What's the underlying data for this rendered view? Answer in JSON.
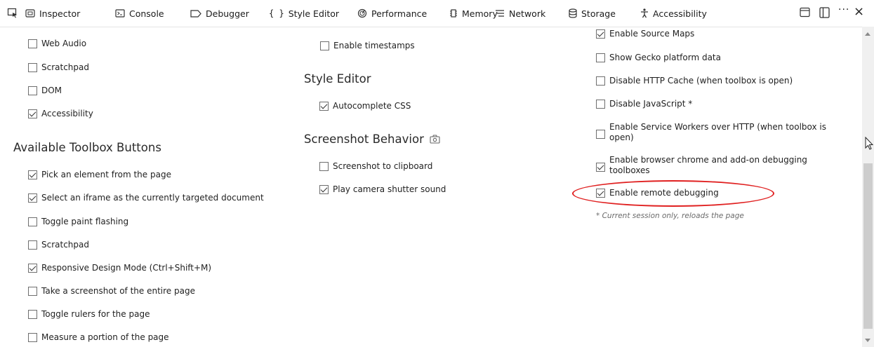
{
  "toolbar": {
    "tabs": [
      {
        "label": "Inspector",
        "icon": "inspector-icon"
      },
      {
        "label": "Console",
        "icon": "console-icon"
      },
      {
        "label": "Debugger",
        "icon": "debugger-icon"
      },
      {
        "label": "Style Editor",
        "icon": "style-editor-icon"
      },
      {
        "label": "Performance",
        "icon": "performance-icon"
      },
      {
        "label": "Memory",
        "icon": "memory-icon"
      },
      {
        "label": "Network",
        "icon": "network-icon"
      },
      {
        "label": "Storage",
        "icon": "storage-icon"
      },
      {
        "label": "Accessibility",
        "icon": "accessibility-icon"
      }
    ],
    "menu_label": "···",
    "close_label": "×"
  },
  "col1": {
    "tools": [
      {
        "label": "Web Audio",
        "checked": false
      },
      {
        "label": "Scratchpad",
        "checked": false
      },
      {
        "label": "DOM",
        "checked": false
      },
      {
        "label": "Accessibility",
        "checked": true
      }
    ],
    "toolbox_heading": "Available Toolbox Buttons",
    "toolbox_buttons": [
      {
        "label": "Pick an element from the page",
        "checked": true
      },
      {
        "label": "Select an iframe as the currently targeted document",
        "checked": true
      },
      {
        "label": "Toggle paint flashing",
        "checked": false
      },
      {
        "label": "Scratchpad",
        "checked": false
      },
      {
        "label": "Responsive Design Mode (Ctrl+Shift+M)",
        "checked": true
      },
      {
        "label": "Take a screenshot of the entire page",
        "checked": false
      },
      {
        "label": "Toggle rulers for the page",
        "checked": false
      },
      {
        "label": "Measure a portion of the page",
        "checked": false
      }
    ]
  },
  "col2": {
    "timestamps": {
      "label": "Enable timestamps",
      "checked": false
    },
    "style_editor_heading": "Style Editor",
    "autocomplete": {
      "label": "Autocomplete CSS",
      "checked": true
    },
    "screenshot_heading": "Screenshot Behavior",
    "screenshot_options": [
      {
        "label": "Screenshot to clipboard",
        "checked": false
      },
      {
        "label": "Play camera shutter sound",
        "checked": true
      }
    ]
  },
  "col3": {
    "advanced": [
      {
        "label": "Enable Source Maps",
        "checked": true
      },
      {
        "label": "Show Gecko platform data",
        "checked": false
      },
      {
        "label": "Disable HTTP Cache (when toolbox is open)",
        "checked": false
      },
      {
        "label": "Disable JavaScript *",
        "checked": false
      },
      {
        "label": "Enable Service Workers over HTTP (when toolbox is open)",
        "checked": false
      },
      {
        "label": "Enable browser chrome and add-on debugging toolboxes",
        "checked": true
      },
      {
        "label": "Enable remote debugging",
        "checked": true
      }
    ],
    "note": "* Current session only, reloads the page"
  },
  "colors": {
    "highlight": "#e02020",
    "accent": "#0a84ff"
  }
}
